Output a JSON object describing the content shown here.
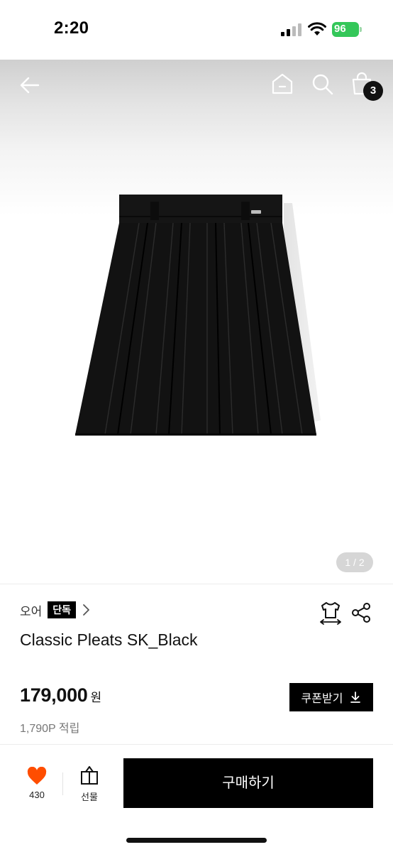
{
  "status_bar": {
    "time": "2:20",
    "battery": "96",
    "battery_color": "#34c759"
  },
  "nav": {
    "icons": [
      "back-arrow-icon",
      "home-icon",
      "search-icon",
      "shopping-bag-icon"
    ],
    "cart_count": "3"
  },
  "gallery": {
    "page_indicator": "1 / 2"
  },
  "product": {
    "brand": "오어",
    "exclusive_tag": "단독",
    "title": "Classic Pleats SK_Black",
    "price": "179,000",
    "price_unit": "원",
    "points": "1,790P 적립"
  },
  "actions": {
    "coupon_label": "쿠폰받기",
    "like_count": "430",
    "gift_label": "선물",
    "buy_label": "구매하기"
  },
  "colors": {
    "accent_heart": "#ff4d00",
    "primary_button": "#000000"
  }
}
